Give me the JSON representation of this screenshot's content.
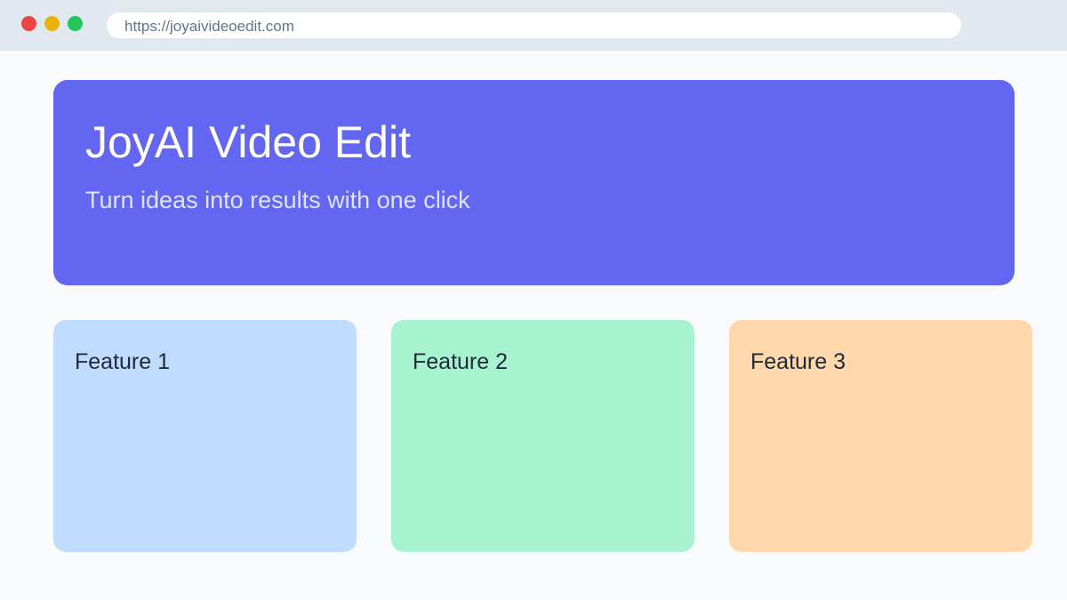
{
  "browser": {
    "url": "https://joyaivideoedit.com",
    "buttons": [
      {
        "name": "close",
        "color": "#ef4444"
      },
      {
        "name": "minimize",
        "color": "#eab308"
      },
      {
        "name": "maximize",
        "color": "#22c55e"
      }
    ]
  },
  "hero": {
    "title": "JoyAI Video Edit",
    "subtitle": "Turn ideas into results with one click",
    "background": "#6366f1"
  },
  "features": [
    {
      "title": "Feature 1",
      "color": "#bfdbfe"
    },
    {
      "title": "Feature 2",
      "color": "#a7f3d0"
    },
    {
      "title": "Feature 3",
      "color": "#fed7aa"
    }
  ]
}
